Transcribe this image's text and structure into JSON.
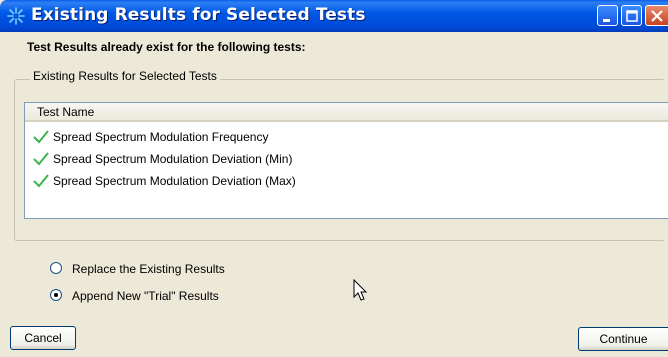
{
  "window": {
    "title": "Existing Results for Selected Tests",
    "buttons": [
      "minimize",
      "maximize",
      "close"
    ]
  },
  "header": {
    "message": "Test Results already exist for the following tests:"
  },
  "group": {
    "legend": "Existing Results for Selected Tests",
    "list": {
      "column_header": "Test Name",
      "items": [
        {
          "label": "Spread Spectrum Modulation Frequency",
          "icon": "checkmark-icon"
        },
        {
          "label": "Spread Spectrum Modulation Deviation (Min)",
          "icon": "checkmark-icon"
        },
        {
          "label": "Spread Spectrum Modulation Deviation (Max)",
          "icon": "checkmark-icon"
        }
      ]
    }
  },
  "options": {
    "replace_label": "Replace the Existing Results",
    "append_label": "Append New \"Trial\" Results",
    "selected": "append"
  },
  "actions": {
    "cancel_label": "Cancel",
    "continue_label": "Continue"
  },
  "colors": {
    "titlebar": "#0058e6",
    "dialog_bg": "#ece9d8",
    "checkmark": "#3cb54a"
  }
}
